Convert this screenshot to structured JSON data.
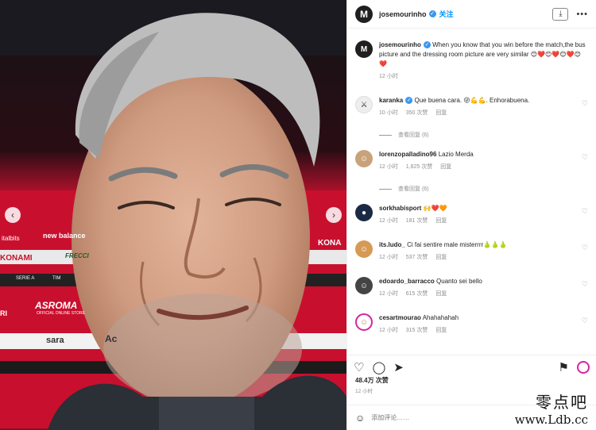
{
  "post": {
    "username": "josemourinho",
    "follow_label": "关注",
    "caption": "When you know that you win before the match,the bus picture and the dressing room picture are very similar 😊❤️😊❤️😊❤️😊❤️",
    "caption_time": "12 小时",
    "likes": "48.4万 次赞",
    "time": "12 小时"
  },
  "photo_text": {
    "brand": "new balance",
    "sponsor1": "KONAMI",
    "sponsor2": "FRECCI",
    "sponsor3": "ASROMA",
    "sponsor3_sub": "OFFICIAL ONLINE STORE",
    "sponsor4": "sara",
    "sponsor5": "KONA",
    "serie_a": "SERIE A",
    "tim": "TIM",
    "bits": "italbits",
    "left1": "RI",
    "left2": "Ac"
  },
  "comments": [
    {
      "user": "karanka",
      "text": "Que buena cara. 😜💪💪. Enhorabuena.",
      "time": "10 小时",
      "likes": "350 次赞",
      "reply": "回复",
      "view_replies": "查看回复 (6)",
      "verified": true
    },
    {
      "user": "lorenzopalladino96",
      "text": "Lazio Merda",
      "time": "12 小时",
      "likes": "1,825 次赞",
      "reply": "回复",
      "view_replies": "查看回复 (6)",
      "verified": false
    },
    {
      "user": "sorkhabisport",
      "text": "🙌❤️🧡",
      "time": "12 小时",
      "likes": "181 次赞",
      "reply": "回复",
      "verified": false
    },
    {
      "user": "its.ludo_",
      "text": "Ci fai sentire male misterrrr🍐🍐🍐",
      "time": "12 小时",
      "likes": "537 次赞",
      "reply": "回复",
      "verified": false
    },
    {
      "user": "edoardo_barracco",
      "text": "Quanto sei bello",
      "time": "12 小时",
      "likes": "615 次赞",
      "reply": "回复",
      "verified": false
    },
    {
      "user": "cesartmourao",
      "text": "Ahahahahah",
      "time": "12 小时",
      "likes": "315 次赞",
      "reply": "回复",
      "verified": false
    }
  ],
  "comment_input": {
    "placeholder": "添加评论……"
  },
  "watermark": {
    "line1": "零点吧",
    "line2": "www.Ldb.cc"
  },
  "icons": [
    "download-icon",
    "more-icon",
    "heart-icon",
    "comment-icon",
    "share-icon",
    "bookmark-icon",
    "emoji-icon",
    "verified-icon"
  ],
  "colors": {
    "accent": "#0095f6",
    "verified": "#3897f0",
    "text": "#262626",
    "muted": "#8e8e8e",
    "roma_red": "#c8102e"
  }
}
